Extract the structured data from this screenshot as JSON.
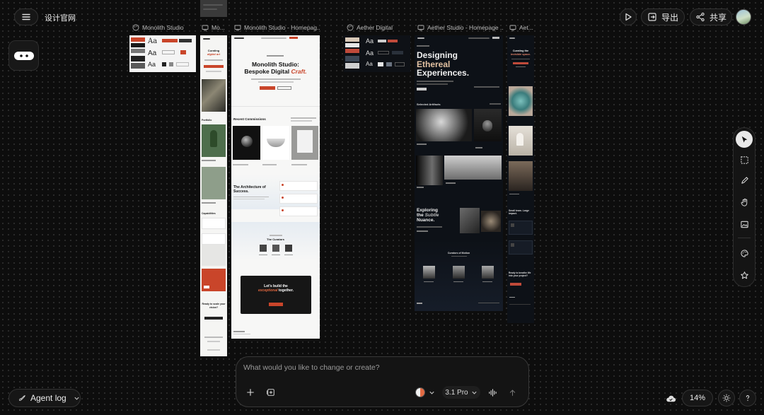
{
  "header": {
    "project_title": "设计官网",
    "export_label": "导出",
    "share_label": "共享"
  },
  "frames": {
    "f1": "Monolith Studio",
    "f2": "Mo...",
    "f3": "Monolith Studio - Homepag...",
    "f4": "Aether Digital",
    "f5": "Aether Studio - Homepage ...",
    "f6": "Aet..."
  },
  "frame_content": {
    "type_aa": "Aa",
    "mobile_hero_l1": "Curating",
    "mobile_hero_l2": "digital art",
    "mobile_portfolio": "Portfolio",
    "mobile_capabilities": "Capabilities",
    "mobile_cta": "Ready to scale your vision?",
    "home_title_l1": "Monolith Studio:",
    "home_title_l2": "Bespoke Digital",
    "home_title_accent": "Craft.",
    "home_recent": "Recent Commissions",
    "home_arch_l1": "The Architecture of",
    "home_arch_l2": "Success.",
    "home_curators": "The Curators",
    "home_build_l1": "Let's build the",
    "home_build_accent": "exceptional",
    "home_build_tail": "together.",
    "aether_hero_l1": "Designing",
    "aether_hero_accent": "Ethereal",
    "aether_hero_l3": "Experiences.",
    "aether_selected": "Selected Artifacts",
    "aether_explore_l1": "Exploring",
    "aether_explore_l2a": "the",
    "aether_explore_l2b": "Subtle",
    "aether_explore_l3": "Nuance.",
    "aether_curators": "Curators of Motion",
    "am_hero_l1": "Curating the",
    "am_hero_accent": "invisible space.",
    "am_small": "Small team. Large impact.",
    "am_cta": "Ready to breathe life into your project?"
  },
  "prompt": {
    "placeholder": "What would you like to change or create?",
    "model_label": "3.1 Pro"
  },
  "footer": {
    "agent_log_label": "Agent log",
    "zoom_label": "14%"
  },
  "colors": {
    "background": "#0d0d0d",
    "accent": "#c9452a",
    "aether_bg": "#0d1117"
  }
}
